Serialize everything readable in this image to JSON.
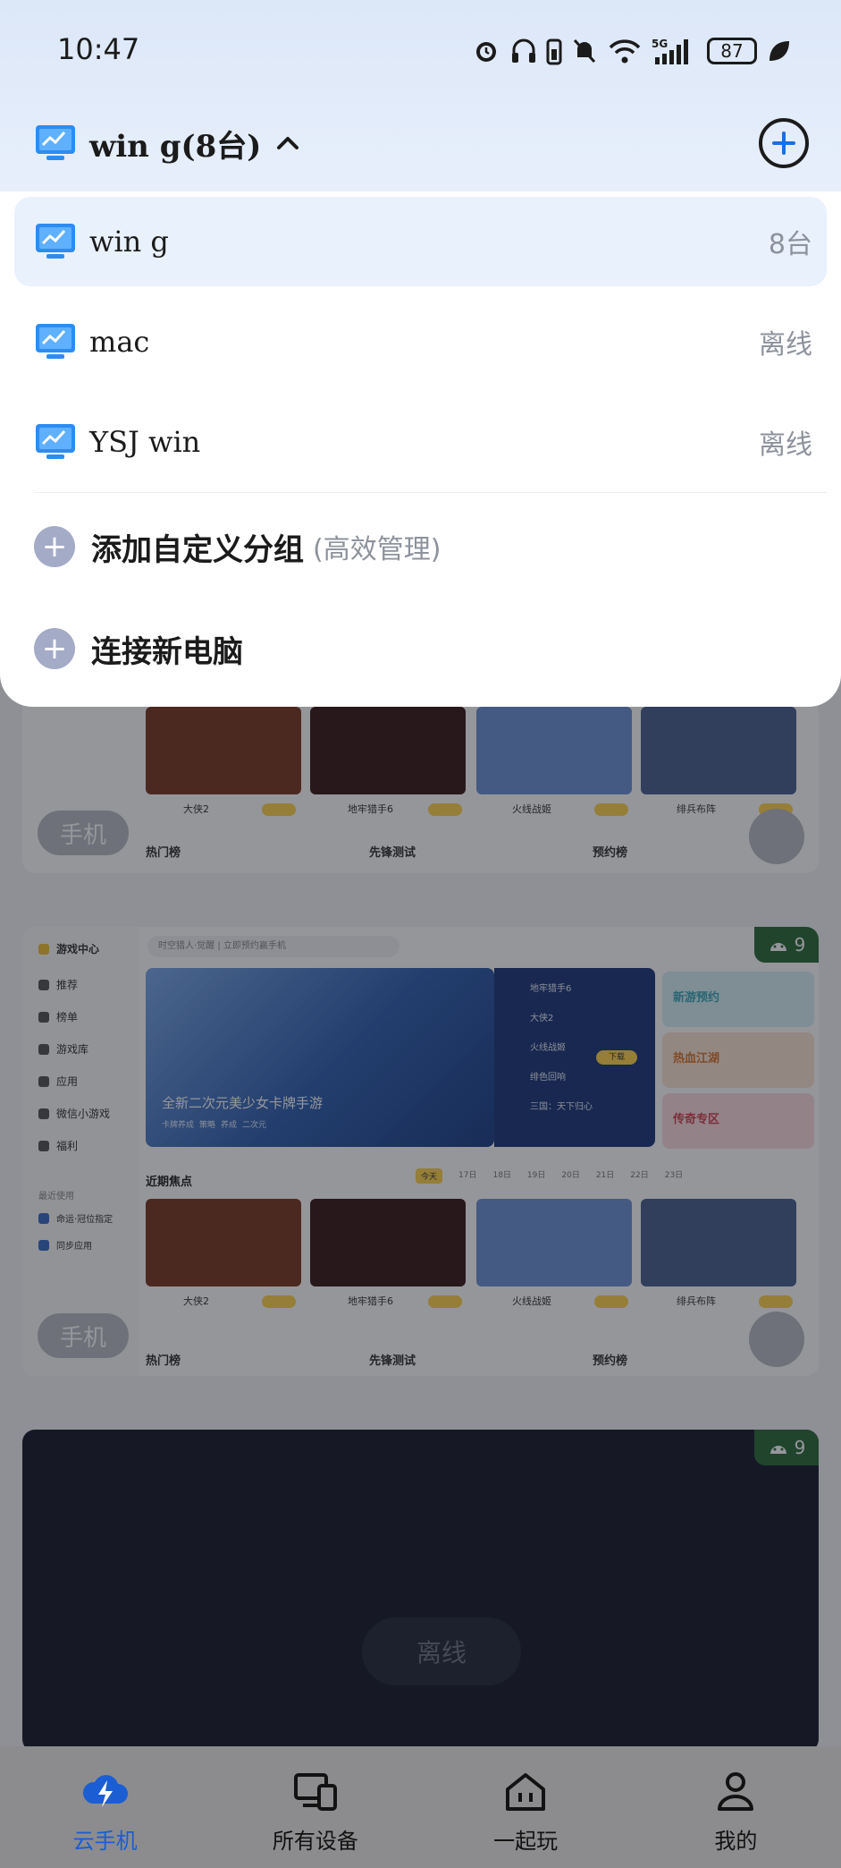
{
  "status_bar": {
    "time": "10:47",
    "battery": "87",
    "network": "5G"
  },
  "header": {
    "group_title": "win g(8台)",
    "add_button_icon": "plus-circle-icon"
  },
  "groups": [
    {
      "name": "win g",
      "status": "8台",
      "selected": true
    },
    {
      "name": "mac",
      "status": "离线",
      "selected": false
    },
    {
      "name": "YSJ win",
      "status": "离线",
      "selected": false
    }
  ],
  "actions": {
    "add_group_label": "添加自定义分组",
    "add_group_hint": "(高效管理)",
    "connect_label": "连接新电脑"
  },
  "devices": [
    {
      "phone_label": "手机",
      "android_count": "9",
      "sidebar_title": "游戏中心",
      "sidebar_items": [
        "推荐",
        "榜单",
        "游戏库",
        "应用",
        "微信小游戏",
        "福利"
      ],
      "recent_title": "最近使用",
      "recent_items": [
        "命运·冠位指定",
        "同步应用"
      ],
      "search_placeholder": "时空猎人·觉醒 | 立即预约赢手机",
      "banner_caption": "全新二次元美少女卡牌手游",
      "banner_tags": [
        "卡牌养成",
        "策略",
        "养成",
        "二次元"
      ],
      "side_games": [
        "地牢猎手6",
        "大侠2",
        "火线战姬",
        "绯色回响",
        "三国：天下归心"
      ],
      "download_label": "下载",
      "promos": [
        "新游预约",
        "热血江湖",
        "传奇专区"
      ],
      "section_title": "近期焦点",
      "dates": [
        "今天",
        "17日",
        "18日",
        "19日",
        "20日",
        "21日",
        "22日",
        "23日"
      ],
      "games": [
        "大侠2",
        "地牢猎手6",
        "火线战姬",
        "绯兵布阵"
      ],
      "ranks": [
        "热门榜",
        "先锋测试",
        "预约榜"
      ]
    },
    {
      "offline_label": "离线",
      "android_count": "9"
    }
  ],
  "top_card": {
    "phone_label": "手机",
    "games": [
      "大侠2",
      "地牢猎手6",
      "火线战姬",
      "绯兵布阵"
    ],
    "ranks": [
      "热门榜",
      "先锋测试",
      "预约榜"
    ]
  },
  "bottom_nav": [
    {
      "label": "云手机",
      "icon": "cloud-lightning-icon",
      "active": true
    },
    {
      "label": "所有设备",
      "icon": "devices-icon",
      "active": false
    },
    {
      "label": "一起玩",
      "icon": "home-play-icon",
      "active": false
    },
    {
      "label": "我的",
      "icon": "profile-icon",
      "active": false
    }
  ],
  "colors": {
    "accent": "#1b5ed3",
    "selected_row": "#e9f1fc",
    "muted_text": "#8d929c",
    "plus_dot": "#a4abc6"
  }
}
